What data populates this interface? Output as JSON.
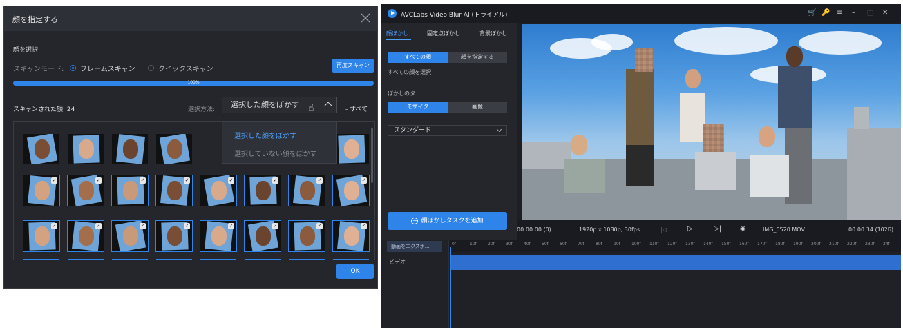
{
  "dialog": {
    "title": "顔を指定する",
    "section_label": "顔を選択",
    "scan_mode_label": "スキャンモード:",
    "scan_modes": [
      "フレームスキャン",
      "クイックスキャン"
    ],
    "rescan_label": "再度スキャン",
    "progress_label": "100%",
    "progress_value": 1.0,
    "scanned_label": "スキャンされた顔: 24",
    "method_label": "選択方法:",
    "method_selected": "選択した顔をぼかす",
    "method_options": [
      "選択した顔をぼかす",
      "選択していない顔をぼかす"
    ],
    "all_label": "すべて",
    "ok_label": "OK"
  },
  "app": {
    "title": "AVCLabs Video Blur AI (トライアル)",
    "tabs": [
      "顔ぼかし",
      "固定点ぼかし",
      "背景ぼかし"
    ],
    "face_mode": [
      "すべての顔",
      "顔を指定する"
    ],
    "all_faces_hint": "すべての顔を選択",
    "blur_type_label": "ぼかしのタ...",
    "blur_types": [
      "モザイク",
      "画像"
    ],
    "blur_level": "スタンダード",
    "add_task_label": "顔ぼかしタスクを追加",
    "time_start": "00:00:00 (0)",
    "resolution": "1920p x 1080p, 30fps",
    "filename": "IMG_0520.MOV",
    "time_end": "00:00:34 (1026)",
    "export_label": "動画をエクスポ...",
    "video_track_label": "ビデオ",
    "ruler": [
      "0f",
      "10f",
      "20f",
      "30f",
      "40f",
      "50f",
      "60f",
      "70f",
      "80f",
      "90f",
      "100f",
      "110f",
      "120f",
      "130f",
      "140f",
      "150f",
      "160f",
      "170f",
      "180f",
      "190f",
      "200f",
      "210f",
      "220f",
      "230f",
      "24f"
    ]
  },
  "colors": {
    "accent": "#2f84ea",
    "dialog_bg": "#24262c",
    "icon_yellow": "#f0b400"
  }
}
